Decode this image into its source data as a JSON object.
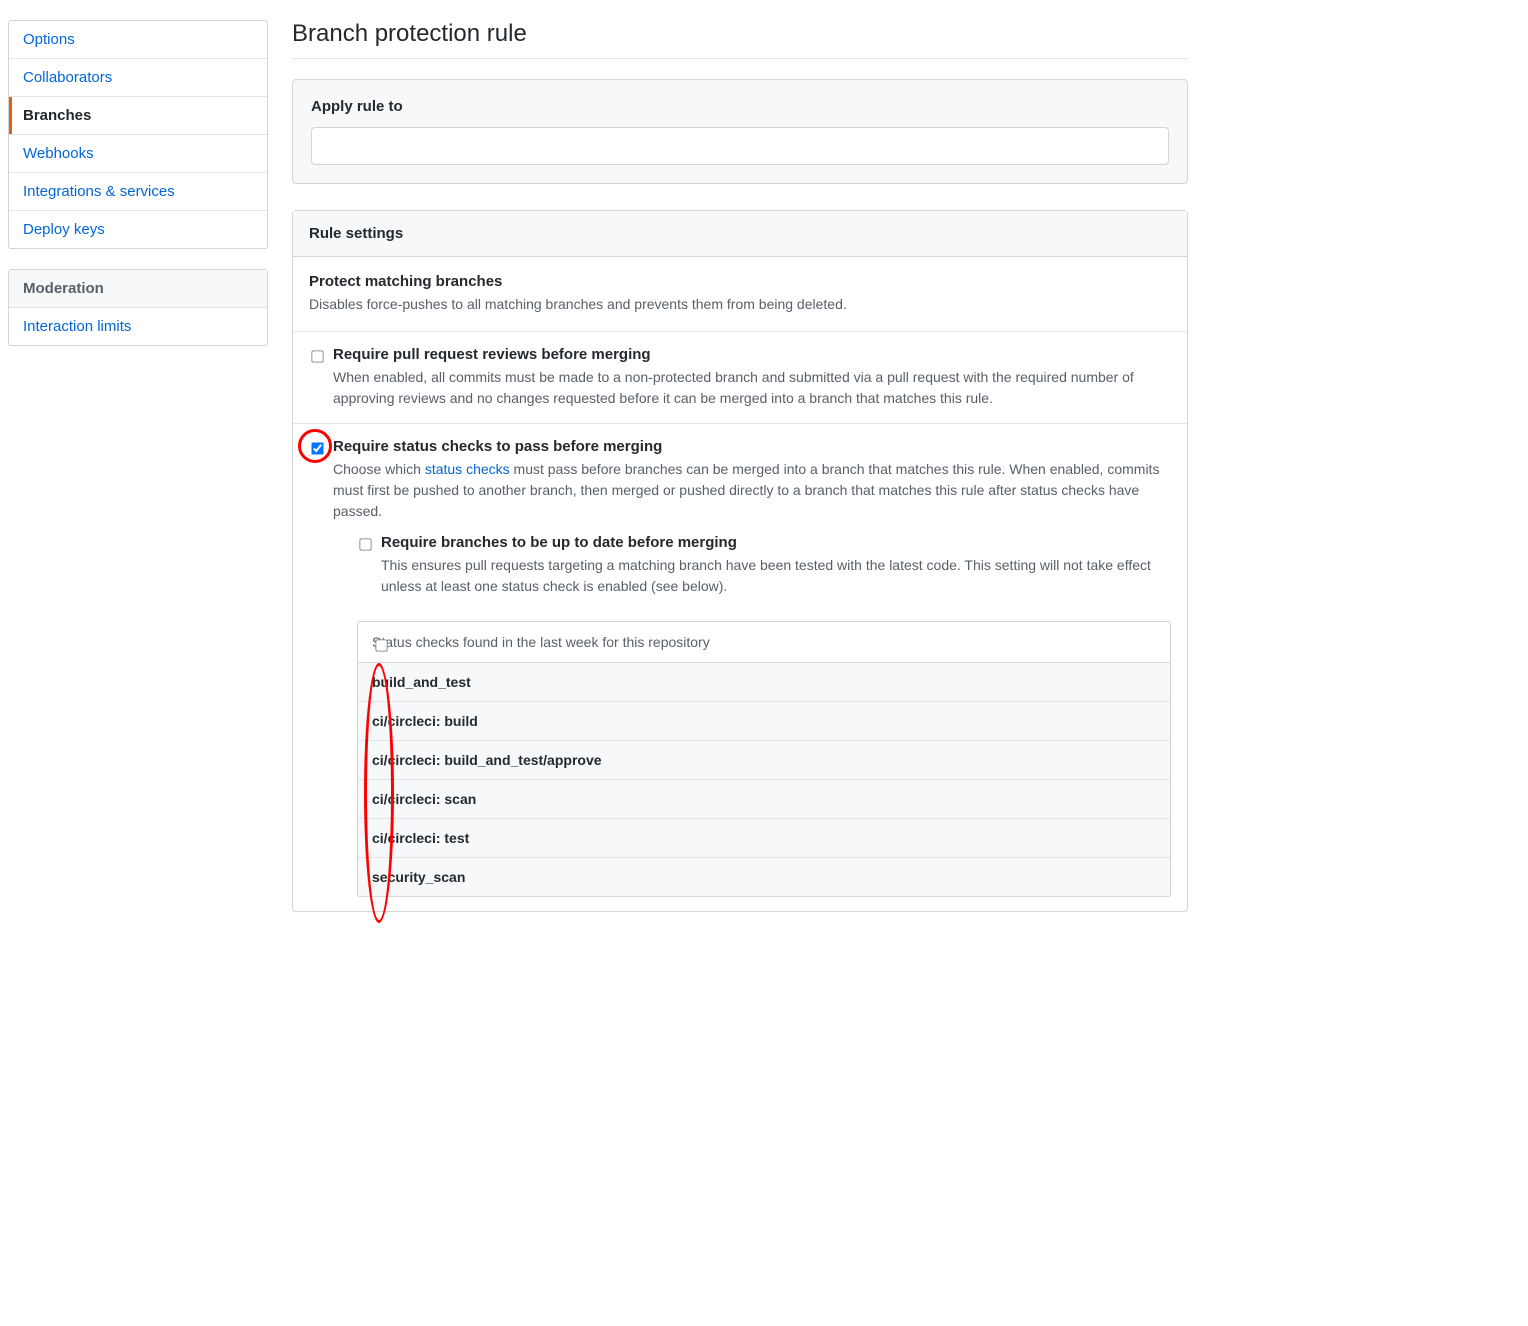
{
  "sidebar": {
    "items": [
      {
        "label": "Options",
        "active": false
      },
      {
        "label": "Collaborators",
        "active": false
      },
      {
        "label": "Branches",
        "active": true
      },
      {
        "label": "Webhooks",
        "active": false
      },
      {
        "label": "Integrations & services",
        "active": false
      },
      {
        "label": "Deploy keys",
        "active": false
      }
    ],
    "moderation_header": "Moderation",
    "moderation_items": [
      {
        "label": "Interaction limits"
      }
    ]
  },
  "page_title": "Branch protection rule",
  "apply": {
    "label": "Apply rule to",
    "value": ""
  },
  "rule_settings_header": "Rule settings",
  "protect": {
    "title": "Protect matching branches",
    "desc": "Disables force-pushes to all matching branches and prevents them from being deleted."
  },
  "require_pr": {
    "title": "Require pull request reviews before merging",
    "desc": "When enabled, all commits must be made to a non-protected branch and submitted via a pull request with the required number of approving reviews and no changes requested before it can be merged into a branch that matches this rule.",
    "checked": false
  },
  "require_status": {
    "title": "Require status checks to pass before merging",
    "desc_pre": "Choose which ",
    "desc_link": "status checks",
    "desc_post": " must pass before branches can be merged into a branch that matches this rule. When enabled, commits must first be pushed to another branch, then merged or pushed directly to a branch that matches this rule after status checks have passed.",
    "checked": true
  },
  "require_uptodate": {
    "title": "Require branches to be up to date before merging",
    "desc": "This ensures pull requests targeting a matching branch have been tested with the latest code. This setting will not take effect unless at least one status check is enabled (see below).",
    "checked": false
  },
  "status_checks": {
    "header": "Status checks found in the last week for this repository",
    "items": [
      {
        "label": "build_and_test",
        "checked": false
      },
      {
        "label": "ci/circleci: build",
        "checked": false
      },
      {
        "label": "ci/circleci: build_and_test/approve",
        "checked": false
      },
      {
        "label": "ci/circleci: scan",
        "checked": false
      },
      {
        "label": "ci/circleci: test",
        "checked": false
      },
      {
        "label": "security_scan",
        "checked": false
      }
    ]
  }
}
